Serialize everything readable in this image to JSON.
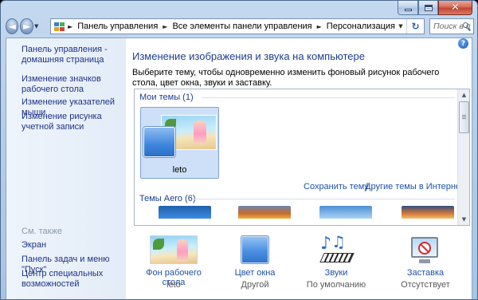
{
  "window": {
    "close_glyph": "✕"
  },
  "nav": {
    "back_glyph": "◄",
    "forward_glyph": "►",
    "history_glyph": "▼",
    "breadcrumbs": [
      "Панель управления",
      "Все элементы панели управления",
      "Персонализация"
    ],
    "separator": "►",
    "dropdown_glyph": "▼",
    "refresh_glyph": "↻",
    "search_placeholder": "Поиск в п"
  },
  "help_glyph": "?",
  "sidebar": {
    "home_link": "Панель управления - домашняя страница",
    "links": [
      "Изменение значков рабочего стола",
      "Изменение указателей мыши",
      "Изменение рисунка учетной записи"
    ],
    "see_also_heading": "См. также",
    "see_also": [
      "Экран",
      "Панель задач и меню \"Пуск\"",
      "Центр специальных возможностей"
    ]
  },
  "main": {
    "title": "Изменение изображения и звука на компьютере",
    "description": "Выберите тему, чтобы одновременно изменить фоновый рисунок рабочего стола, цвет окна, звуки и заставку.",
    "my_themes_heading": "Мои темы (1)",
    "selected_theme": "leto",
    "save_theme_link": "Сохранить тему",
    "more_themes_link": "Другие темы в Интернете",
    "aero_heading": "Темы Aero (6)",
    "scroll_up_glyph": "▲",
    "scroll_down_glyph": "▼"
  },
  "settings": [
    {
      "label": "Фон рабочего стола",
      "value": "leto",
      "icon": "desktop-background-icon"
    },
    {
      "label": "Цвет окна",
      "value": "Другой",
      "icon": "window-color-icon"
    },
    {
      "label": "Звуки",
      "value": "По умолчанию",
      "icon": "sounds-icon"
    },
    {
      "label": "Заставка",
      "value": "Отсутствует",
      "icon": "screensaver-icon"
    }
  ],
  "colors": {
    "link": "#1e52a7",
    "heading": "#1e3e8c",
    "selection": "#cde0f7",
    "frame": "#b6cee8"
  }
}
